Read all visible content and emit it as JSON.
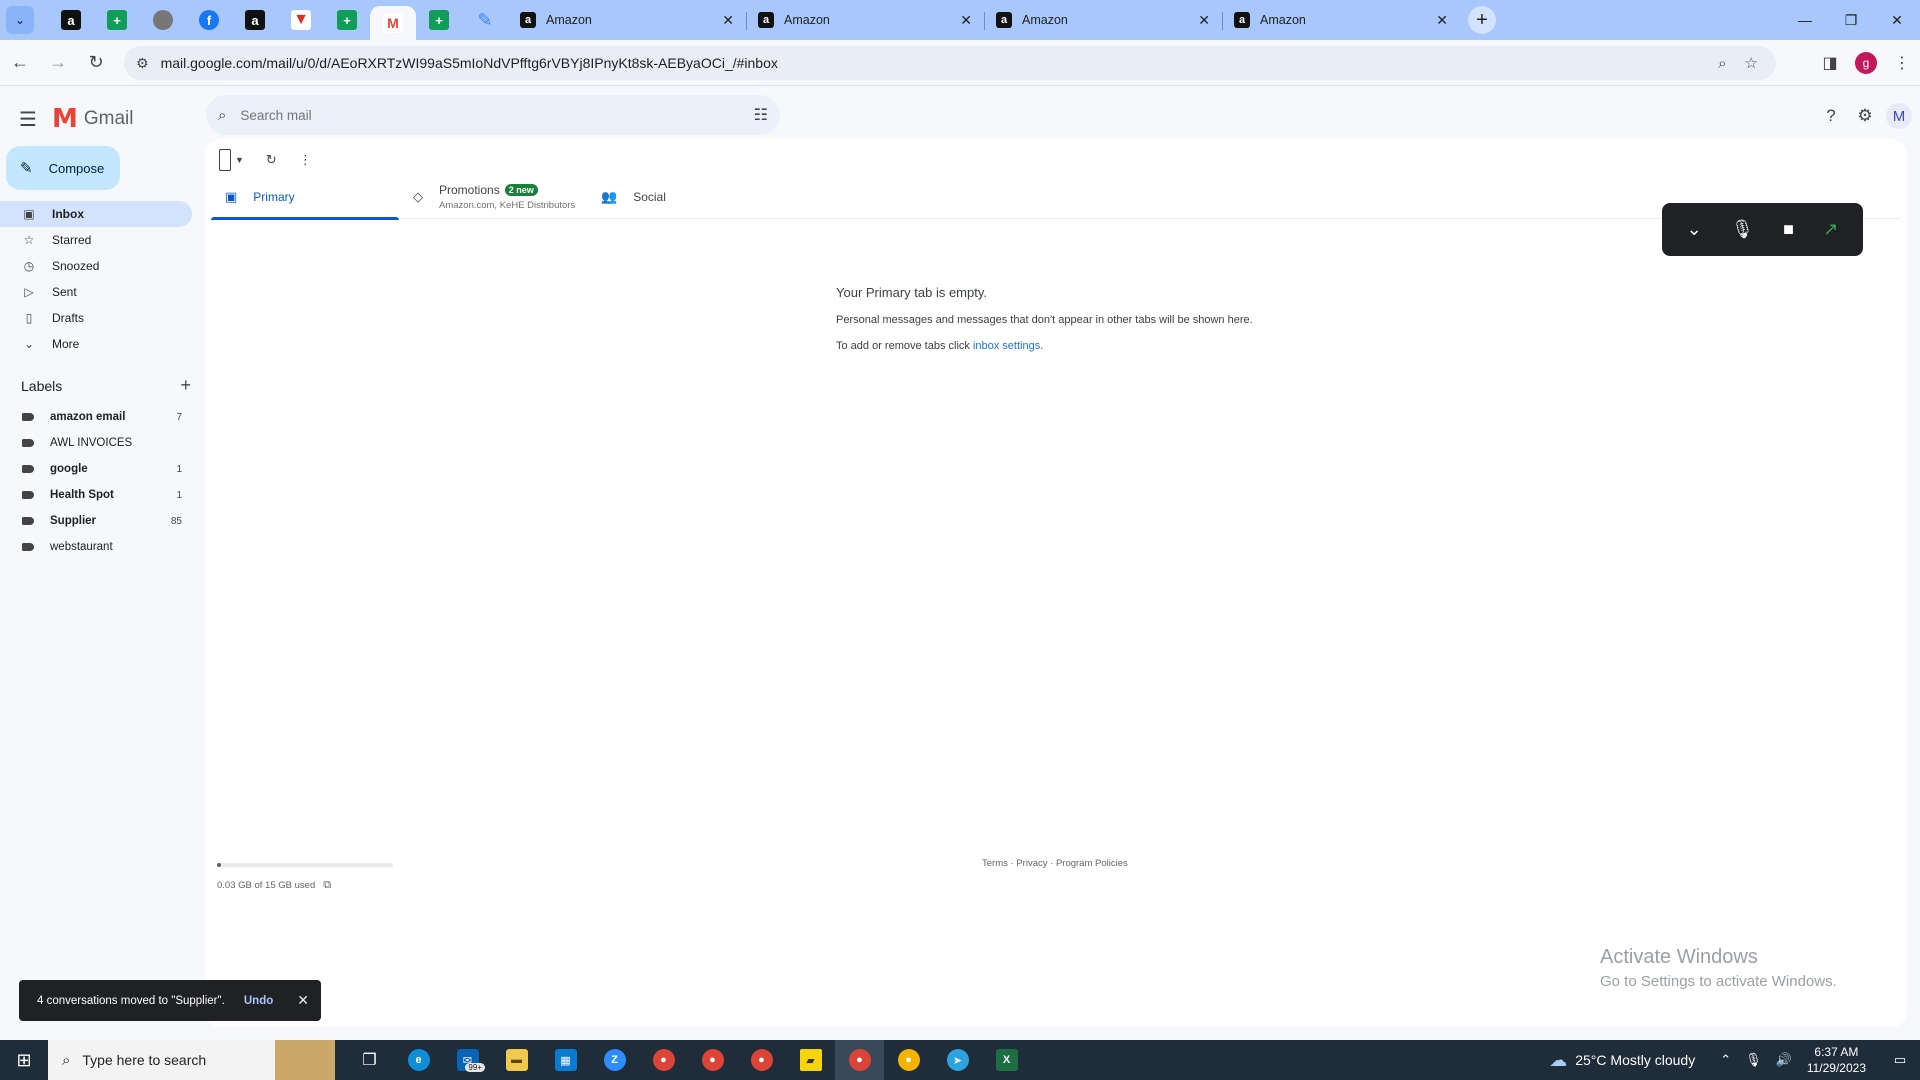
{
  "browser": {
    "tabs": [
      {
        "title": "Amazon"
      },
      {
        "title": "Amazon"
      },
      {
        "title": "Amazon"
      },
      {
        "title": "Amazon"
      }
    ],
    "url": "mail.google.com/mail/u/0/d/AEoRXRTzWI99aS5mIoNdVPfftg6rVBYj8IPnyKt8sk-AEByaOCi_/#inbox",
    "profile_initial": "g"
  },
  "gmail": {
    "logo_text": "Gmail",
    "search_placeholder": "Search mail",
    "avatar_initial": "M",
    "compose_label": "Compose",
    "nav": [
      {
        "label": "Inbox",
        "icon": "inbox-icon"
      },
      {
        "label": "Starred",
        "icon": "star-icon"
      },
      {
        "label": "Snoozed",
        "icon": "clock-icon"
      },
      {
        "label": "Sent",
        "icon": "send-icon"
      },
      {
        "label": "Drafts",
        "icon": "draft-icon"
      },
      {
        "label": "More",
        "icon": "chevron-down-icon"
      }
    ],
    "labels_title": "Labels",
    "labels": [
      {
        "name": "amazon email",
        "count": "7",
        "bold": true
      },
      {
        "name": "AWL INVOICES",
        "count": "",
        "bold": false
      },
      {
        "name": "google",
        "count": "1",
        "bold": true
      },
      {
        "name": "Health Spot",
        "count": "1",
        "bold": true
      },
      {
        "name": "Supplier",
        "count": "85",
        "bold": true
      },
      {
        "name": "webstaurant",
        "count": "",
        "bold": false
      }
    ],
    "categories": {
      "primary": "Primary",
      "promotions": "Promotions",
      "promotions_badge": "2 new",
      "promotions_sub": "Amazon.com, KeHE Distributors",
      "social": "Social"
    },
    "empty": {
      "heading": "Your Primary tab is empty.",
      "line1": "Personal messages and messages that don't appear in other tabs will be shown here.",
      "line2_prefix": "To add or remove tabs click ",
      "line2_link": "inbox settings",
      "line2_suffix": "."
    },
    "storage": {
      "text": "0.03 GB of 15 GB used",
      "fraction": 0.002
    },
    "footer": {
      "terms": "Terms",
      "privacy": "Privacy",
      "policies": "Program Policies",
      "sep": " · "
    },
    "snackbar": {
      "message": "4 conversations moved to \"Supplier\".",
      "undo": "Undo"
    }
  },
  "watermark": {
    "line1": "Activate Windows",
    "line2": "Go to Settings to activate Windows."
  },
  "taskbar": {
    "search_placeholder": "Type here to search",
    "weather": "25°C  Mostly cloudy",
    "time": "6:37 AM",
    "date": "11/29/2023",
    "mail_badge": "99+"
  }
}
